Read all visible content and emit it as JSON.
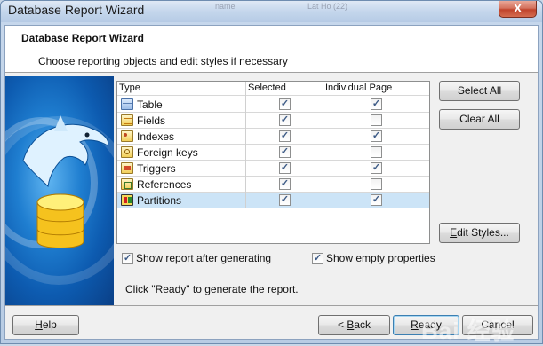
{
  "window": {
    "title": "Database Report Wizard",
    "background_tabs": [
      "name",
      "Lat Ho (22)"
    ],
    "close_symbol": "X"
  },
  "header": {
    "title": "Database Report Wizard",
    "subtitle": "Choose reporting objects and edit styles if necessary"
  },
  "grid": {
    "columns": [
      "Type",
      "Selected",
      "Individual Page"
    ],
    "rows": [
      {
        "label": "Table",
        "icon": "table-icon",
        "selected": true,
        "individual": true
      },
      {
        "label": "Fields",
        "icon": "fields-icon",
        "selected": true,
        "individual": false
      },
      {
        "label": "Indexes",
        "icon": "indexes-icon",
        "selected": true,
        "individual": true
      },
      {
        "label": "Foreign keys",
        "icon": "foreign-keys-icon",
        "selected": true,
        "individual": false
      },
      {
        "label": "Triggers",
        "icon": "triggers-icon",
        "selected": true,
        "individual": true
      },
      {
        "label": "References",
        "icon": "references-icon",
        "selected": true,
        "individual": false
      },
      {
        "label": "Partitions",
        "icon": "partitions-icon",
        "selected": true,
        "individual": true,
        "highlighted": true
      }
    ]
  },
  "side_buttons": {
    "select_all": "Select All",
    "clear_all": "Clear All",
    "edit_styles": "Edit Styles..."
  },
  "options": {
    "show_report": {
      "label": "Show report after generating",
      "checked": true
    },
    "show_empty": {
      "label": "Show empty properties",
      "checked": true
    }
  },
  "info_text": "Click \"Ready\" to generate the report.",
  "footer": {
    "help": "Help",
    "back": "< Back",
    "ready": "Ready",
    "cancel": "Cancel"
  },
  "watermark": "Bai 经验",
  "colors": {
    "selected_row": "#cce4f7",
    "header_bg": "#ffffff",
    "dialog_bg": "#f0f0f0",
    "side_image": "#1f7ed0"
  }
}
